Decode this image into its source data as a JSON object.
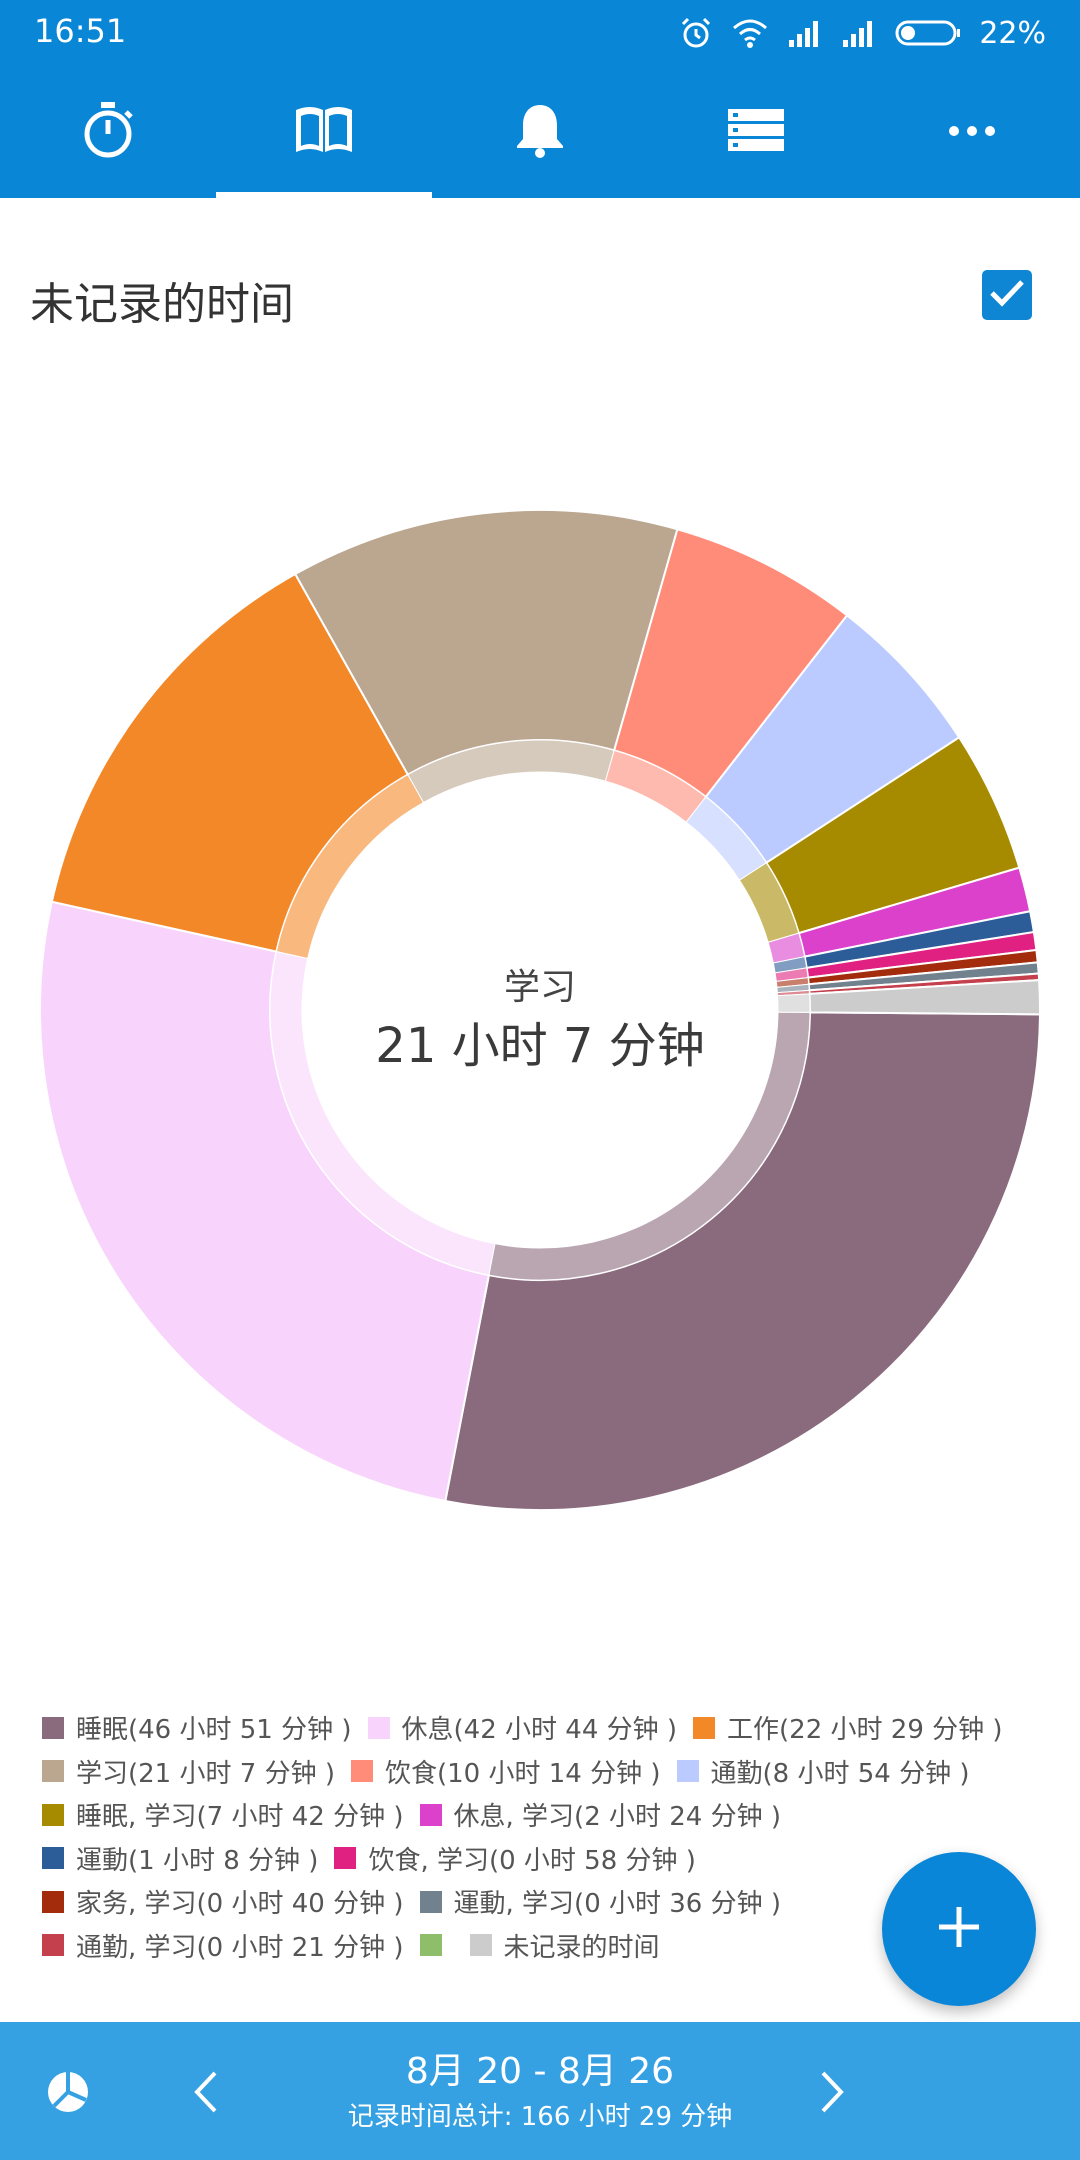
{
  "status_bar": {
    "time": "16:51",
    "battery": "22%",
    "icons": [
      "alarm-icon",
      "wifi-icon",
      "signal-icon",
      "signal-icon",
      "battery-icon"
    ]
  },
  "tabs": [
    {
      "name": "timer",
      "icon": "stopwatch-icon",
      "selected": false
    },
    {
      "name": "statistics",
      "icon": "book-icon",
      "selected": true
    },
    {
      "name": "reminders",
      "icon": "bell-icon",
      "selected": false
    },
    {
      "name": "list",
      "icon": "list-icon",
      "selected": false
    },
    {
      "name": "more",
      "icon": "more-icon",
      "selected": false
    }
  ],
  "filter": {
    "label": "未记录的时间",
    "checked": true
  },
  "chart_data": {
    "type": "pie",
    "donut": true,
    "highlighted": {
      "category": "学习",
      "value": "21 小时 7 分钟"
    },
    "categories": [
      "睡眠",
      "休息",
      "工作",
      "学习",
      "饮食",
      "通勤",
      "睡眠, 学习",
      "休息, 学习",
      "運動",
      "饮食, 学习",
      "家务, 学习",
      "運動, 学习",
      "通勤, 学习",
      "未记录的时间"
    ],
    "values_minutes": [
      2811,
      2564,
      1349,
      1267,
      614,
      534,
      462,
      144,
      68,
      58,
      40,
      36,
      21,
      110
    ],
    "colors": [
      "#8a6a7d",
      "#f8d4fc",
      "#f38828",
      "#bba690",
      "#ff8c79",
      "#bccbff",
      "#a68a00",
      "#db41cb",
      "#2d5d99",
      "#e02181",
      "#a32c0c",
      "#71818e",
      "#c4404c",
      "#cccccc"
    ]
  },
  "legend": {
    "rows": [
      [
        {
          "label": "睡眠(46 小时 51 分钟 )",
          "color": "#8a6a7d"
        },
        {
          "label": "休息(42 小时 44 分钟 )",
          "color": "#f8d4fc"
        },
        {
          "label": "工作(22 小时 29 分钟 )",
          "color": "#f38828"
        }
      ],
      [
        {
          "label": "学习(21 小时 7 分钟 )",
          "color": "#bba690"
        },
        {
          "label": "饮食(10 小时 14 分钟 )",
          "color": "#ff8c79"
        },
        {
          "label": "通勤(8 小时 54 分钟 )",
          "color": "#bccbff"
        }
      ],
      [
        {
          "label": "睡眠, 学习(7 小时 42 分钟 )",
          "color": "#a68a00"
        },
        {
          "label": "休息, 学习(2 小时 24 分钟 )",
          "color": "#db41cb"
        }
      ],
      [
        {
          "label": "運動(1 小时 8 分钟 )",
          "color": "#2d5d99"
        },
        {
          "label": "饮食, 学习(0 小时 58 分钟 )",
          "color": "#e02181"
        }
      ],
      [
        {
          "label": "家务, 学习(0 小时 40 分钟 )",
          "color": "#a32c0c"
        },
        {
          "label": "運動, 学习(0 小时 36 分钟 )",
          "color": "#71818e"
        }
      ],
      [
        {
          "label": "通勤, 学习(0 小时 21 分钟 )",
          "color": "#c4404c"
        },
        {
          "label": "",
          "color": "#8fbe6b"
        },
        {
          "label": "未记录的时间",
          "color": "#cccccc"
        }
      ]
    ]
  },
  "fab": {
    "icon": "plus-icon"
  },
  "bottom_bar": {
    "date_range": "8月 20 - 8月 26",
    "total": "记录时间总计: 166 小时 29 分钟",
    "left_icon": "pie-chart-icon",
    "prev_icon": "chevron-left-icon",
    "next_icon": "chevron-right-icon"
  }
}
